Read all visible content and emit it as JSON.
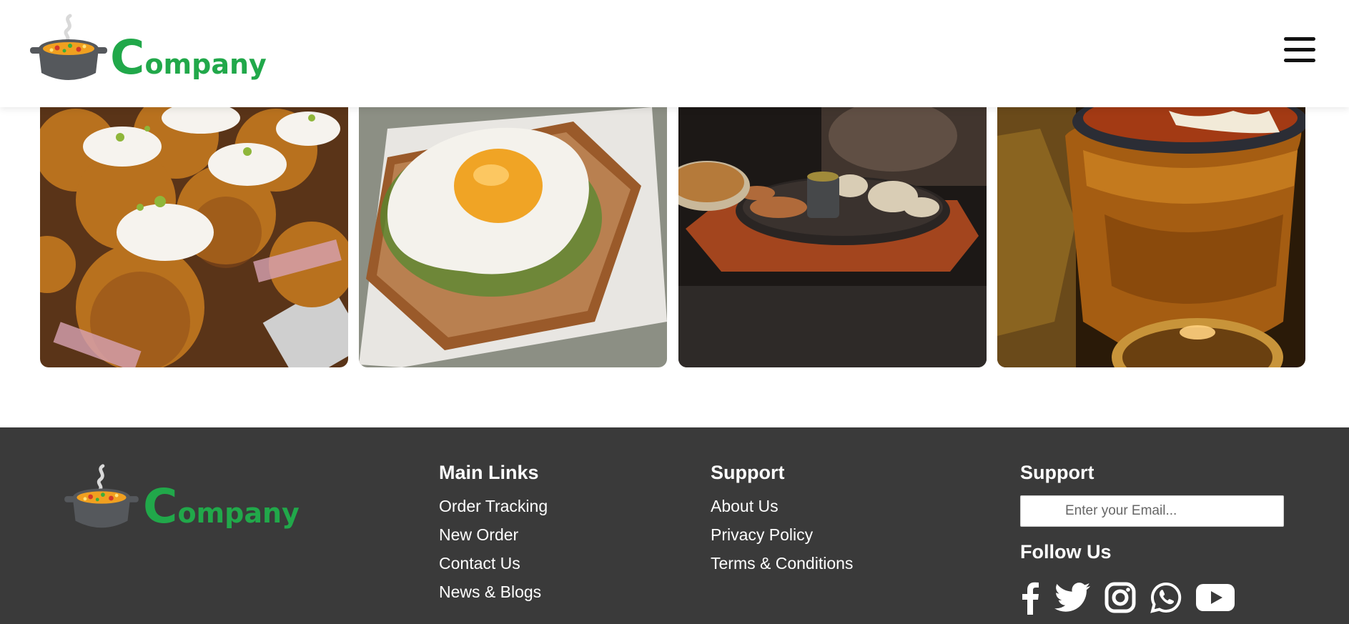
{
  "header": {
    "logo_initial": "C",
    "logo_rest": "ompany"
  },
  "icons": {
    "logo": "cooking-pot-icon",
    "menu": "hamburger-menu-icon",
    "social": [
      "facebook-icon",
      "twitter-icon",
      "instagram-icon",
      "whatsapp-icon",
      "youtube-icon"
    ]
  },
  "gallery": {
    "images": [
      "cupcakes",
      "fried-egg-toast",
      "sizzler-platter",
      "copper-curry-pot"
    ]
  },
  "footer": {
    "logo_initial": "C",
    "logo_rest": "ompany",
    "main_links": {
      "title": "Main Links",
      "items": [
        "Order Tracking",
        "New Order",
        "Contact Us",
        "News & Blogs"
      ]
    },
    "support": {
      "title": "Support",
      "items": [
        "About Us",
        "Privacy Policy",
        "Terms & Conditions"
      ]
    },
    "newsletter": {
      "title": "Support",
      "email_placeholder": "Enter your Email..."
    },
    "follow": {
      "title": "Follow Us"
    }
  },
  "colors": {
    "brand_green": "#21a84a",
    "footer_bg": "#3a3a3a",
    "pot_gray": "#55585c"
  }
}
